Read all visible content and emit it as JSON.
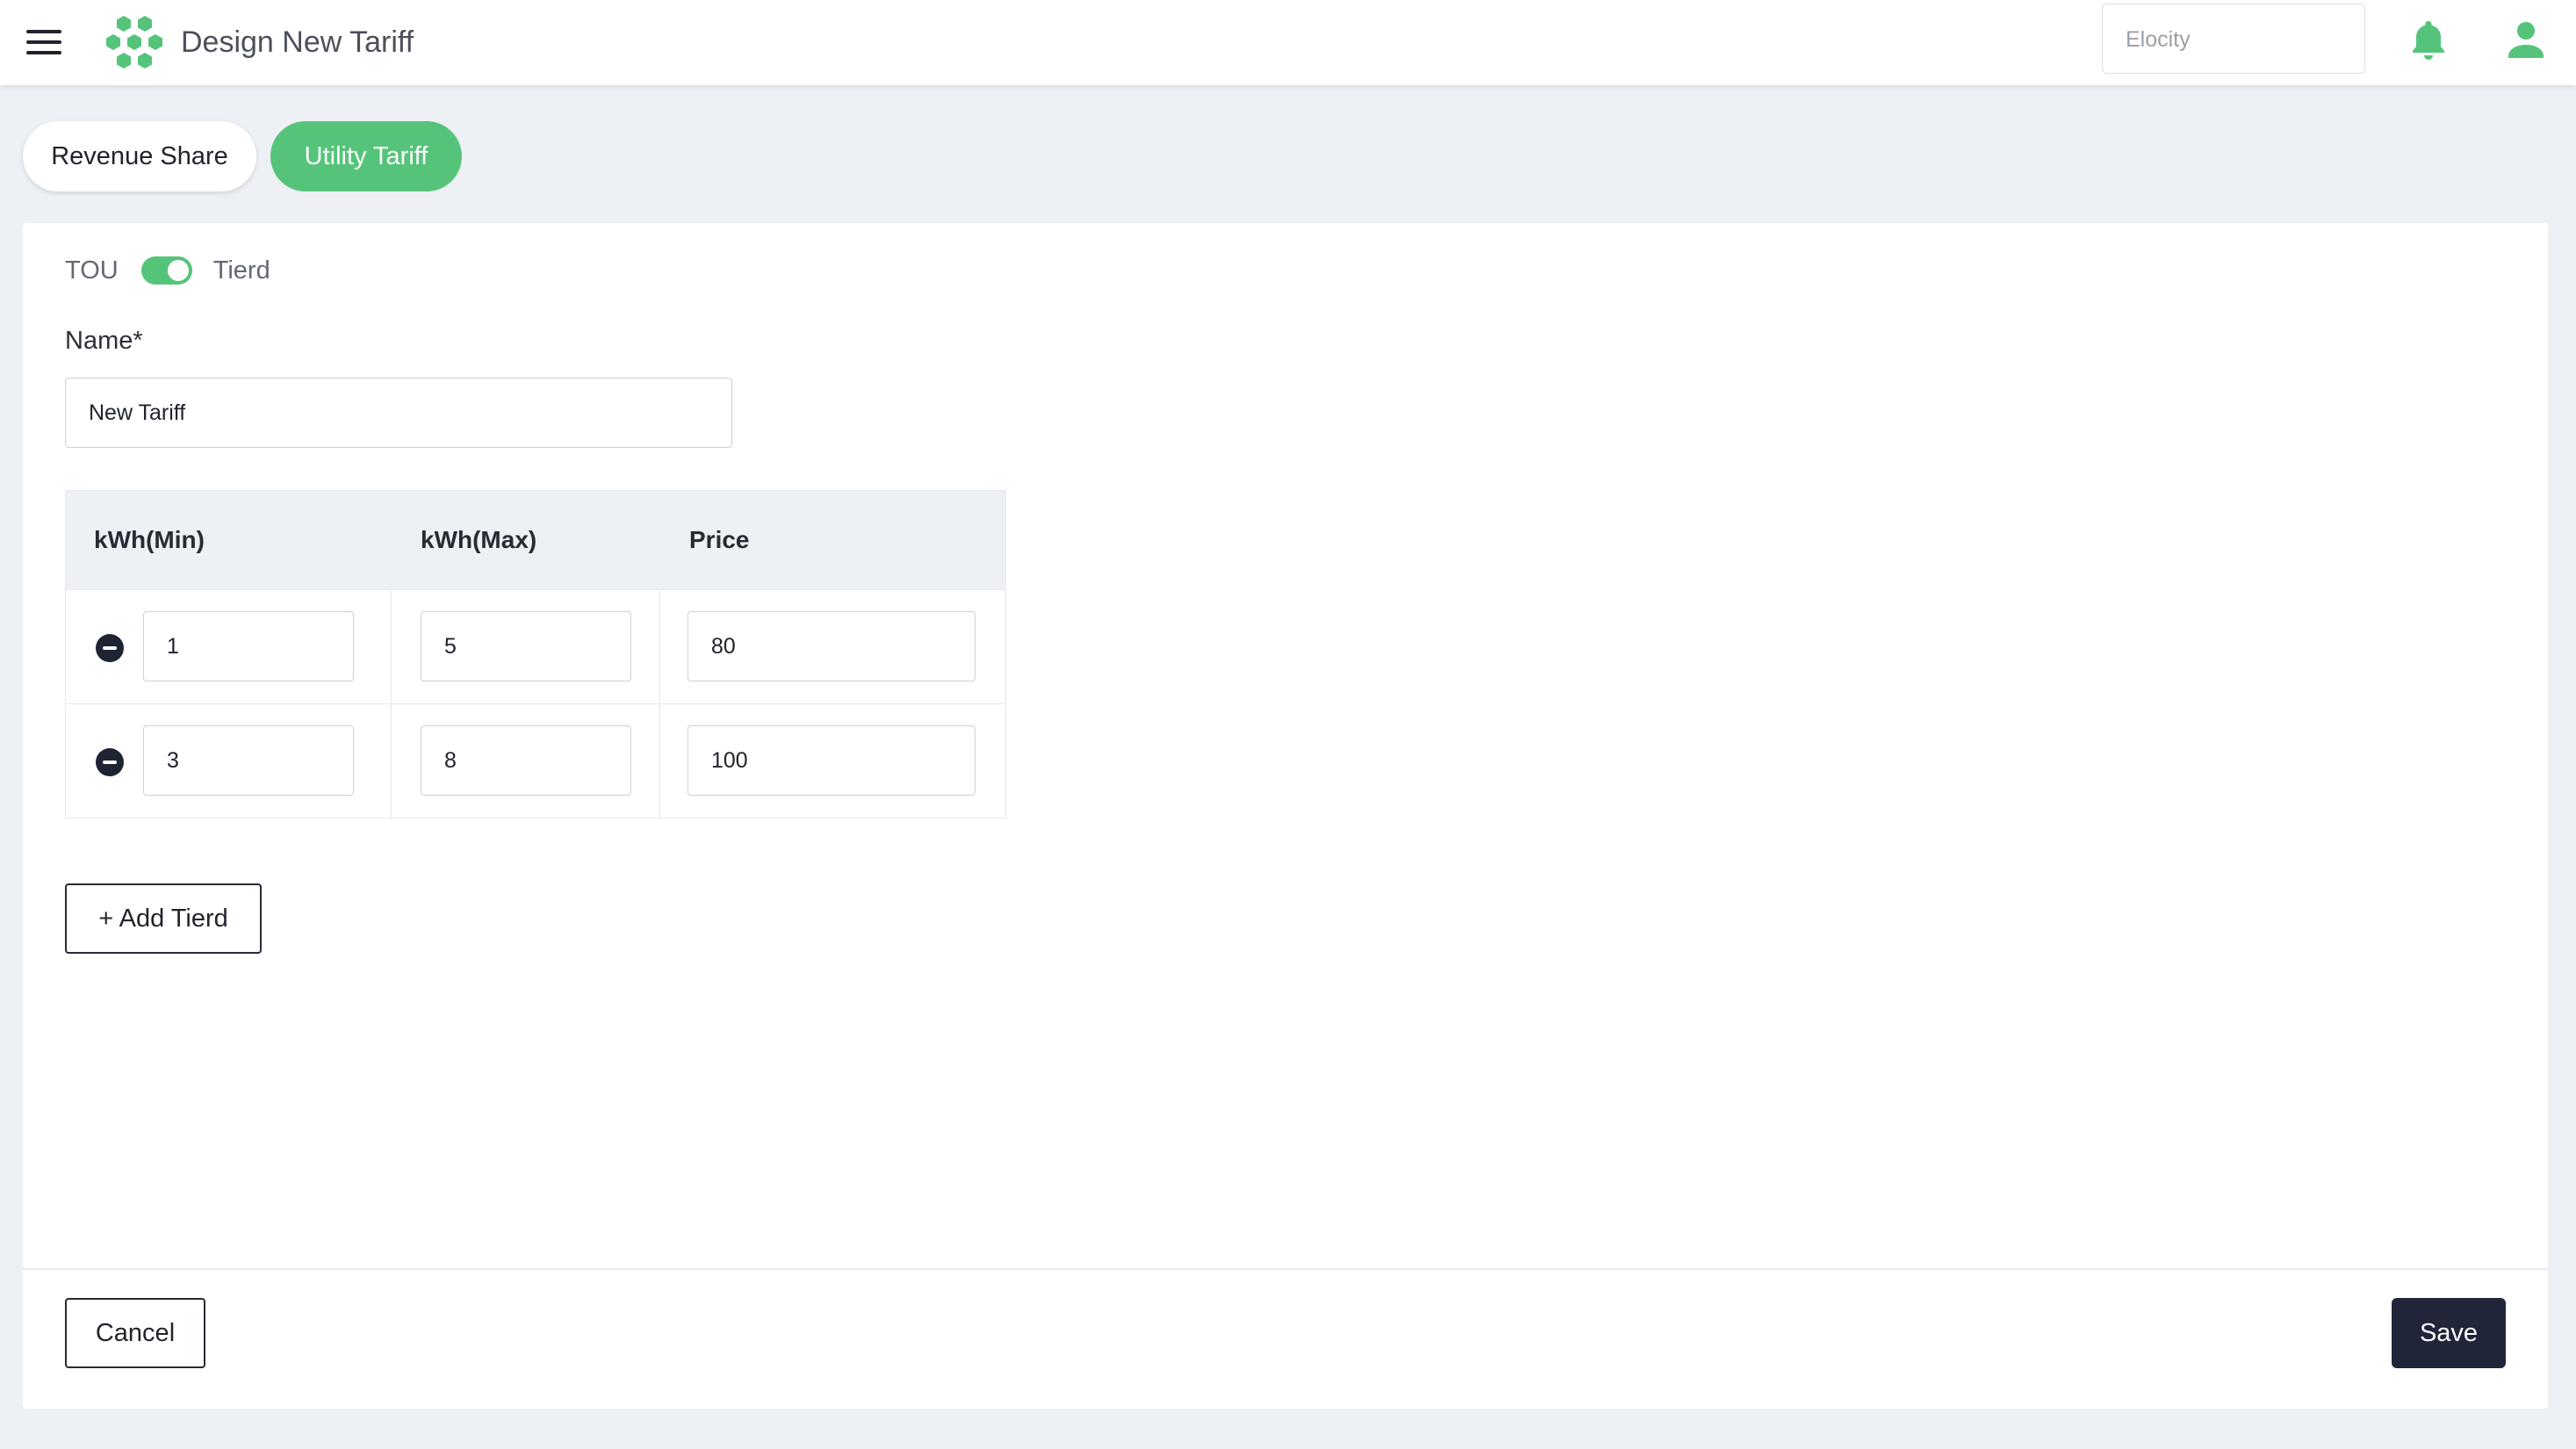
{
  "header": {
    "title": "Design New Tariff",
    "org_select_value": "Elocity",
    "icons": [
      "menu-icon",
      "logo-icon",
      "bell-icon",
      "user-icon"
    ],
    "accent_color": "#55c47a"
  },
  "tabs": [
    {
      "label": "Revenue Share",
      "active": false
    },
    {
      "label": "Utility Tariff",
      "active": true
    }
  ],
  "form": {
    "toggle": {
      "left_label": "TOU",
      "right_label": "Tierd",
      "checked": true
    },
    "name_label": "Name*",
    "name_value": "New Tariff",
    "table": {
      "columns": [
        "kWh(Min)",
        "kWh(Max)",
        "Price"
      ],
      "rows": [
        {
          "min": "1",
          "max": "5",
          "price": "80"
        },
        {
          "min": "3",
          "max": "8",
          "price": "100"
        }
      ]
    },
    "add_tier_label": "+ Add Tierd"
  },
  "footer": {
    "cancel_label": "Cancel",
    "save_label": "Save",
    "save_color": "#20253a"
  }
}
